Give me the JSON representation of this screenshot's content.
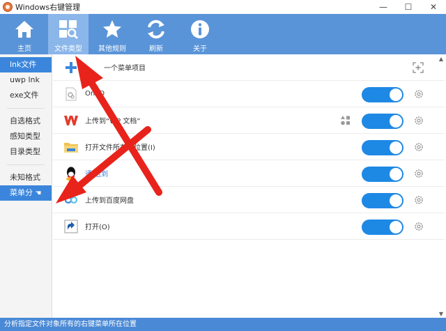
{
  "window": {
    "title": "Windows右键管理",
    "minimize": "—",
    "maximize": "☐",
    "close": "✕"
  },
  "toolbar": {
    "items": [
      {
        "label": "主页",
        "icon": "home-icon"
      },
      {
        "label": "文件类型",
        "icon": "file-type-icon",
        "active": true
      },
      {
        "label": "其他规则",
        "icon": "star-icon"
      },
      {
        "label": "刷新",
        "icon": "refresh-icon"
      },
      {
        "label": "关于",
        "icon": "info-icon"
      }
    ]
  },
  "sidebar": {
    "group1": [
      "lnk文件",
      "uwp lnk",
      "exe文件"
    ],
    "group2": [
      "自选格式",
      "感知类型",
      "目录类型"
    ],
    "group3": [
      "未知格式",
      "菜单分"
    ]
  },
  "content": {
    "add_label": "一个菜单项目",
    "rows": [
      {
        "label": "OneD",
        "icon": "onedrive-icon",
        "enabled": true
      },
      {
        "label": "上传到“WP     文档”",
        "icon": "wps-icon",
        "enabled": true
      },
      {
        "label": "打开文件所在的位置(I)",
        "icon": "folder-icon",
        "enabled": true
      },
      {
        "label": "通       送到",
        "icon": "qq-icon",
        "enabled": true
      },
      {
        "label": "上传到百度网盘",
        "icon": "baidu-icon",
        "enabled": true
      },
      {
        "label": "打开(O)",
        "icon": "shortcut-icon",
        "enabled": true
      }
    ]
  },
  "status": {
    "text": "分析指定文件对象所有的右键菜单所在位置"
  },
  "colors": {
    "toolbar": "#5a94d8",
    "active_tab": "#8ab6ea",
    "toggle": "#1e88e5",
    "status": "#4a89d6",
    "arrow": "#e8231b"
  }
}
